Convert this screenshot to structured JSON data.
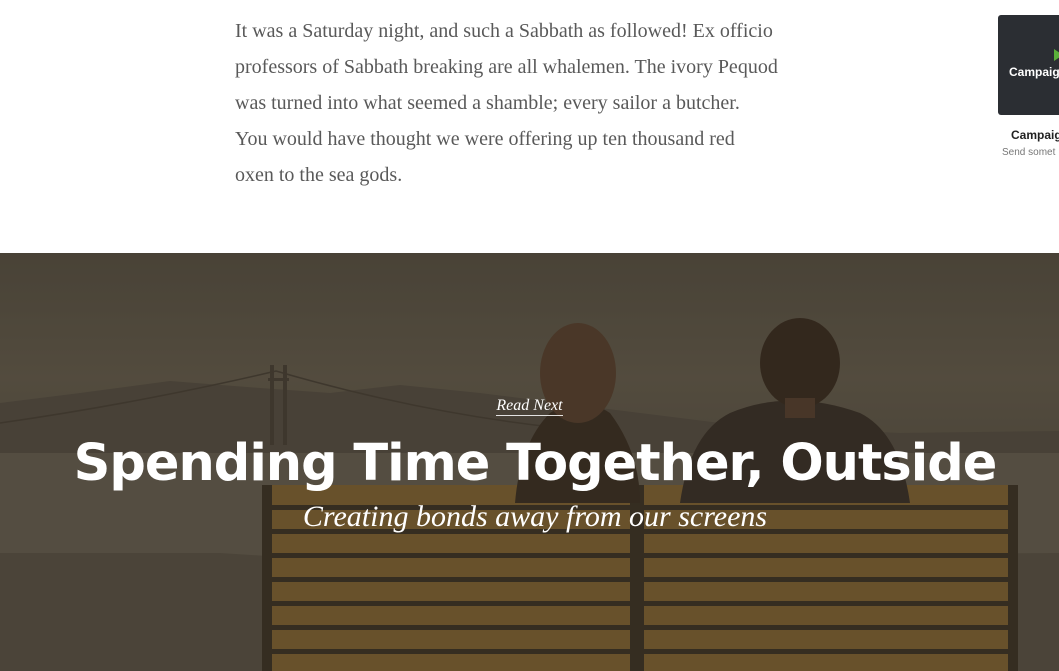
{
  "article": {
    "paragraph": "It was a Saturday night, and such a Sabbath as followed! Ex officio professors of Sabbath breaking are all whalemen. The ivory Pequod was turned into what seemed a shamble; every sailor a butcher. You would have thought we were offering up ten thousand red oxen to the sea gods.",
    "lines": [
      "It was a Saturday night, and such a Sabbath as followed! Ex officio",
      "professors of Sabbath breaking are all whalemen. The ivory Pequod",
      "was turned into what seemed a shamble; every sailor a butcher.",
      "You would have thought we were offering up ten thousand red",
      "oxen to the sea gods."
    ]
  },
  "ad": {
    "logo_text": "Campaig",
    "title": "Campaig",
    "description": "Send somet",
    "colors": {
      "background": "#2b2e33",
      "accent": "#5bb13a"
    }
  },
  "read_next": {
    "label": "Read Next",
    "title": "Spending Time Together, Outside",
    "subtitle": "Creating bonds away from our screens"
  }
}
